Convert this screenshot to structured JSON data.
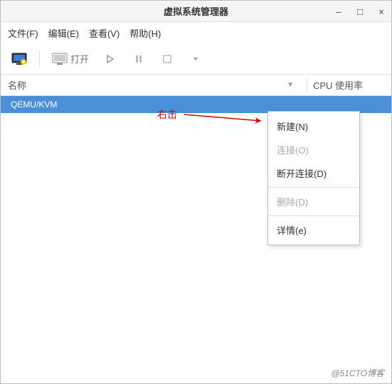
{
  "window": {
    "title": "虚拟系统管理器"
  },
  "menubar": {
    "file": "文件(F)",
    "edit": "编辑(E)",
    "view": "查看(V)",
    "help": "帮助(H)"
  },
  "toolbar": {
    "open_label": "打开"
  },
  "columns": {
    "name": "名称",
    "cpu": "CPU 使用率"
  },
  "list": {
    "selected": "QEMU/KVM"
  },
  "annotation": {
    "label": "右击"
  },
  "context_menu": {
    "new": "新建(N)",
    "connect": "连接(O)",
    "disconnect": "断开连接(D)",
    "delete": "删除(D)",
    "details": "详情(e)"
  },
  "watermark": "@51CTO博客"
}
